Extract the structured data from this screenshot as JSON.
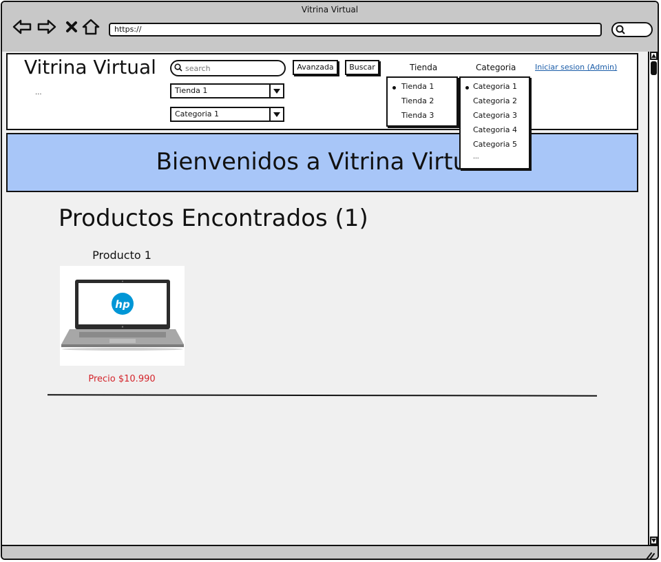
{
  "window": {
    "title": "Vitrina Virtual"
  },
  "browser": {
    "url": "https://",
    "back_icon": "back-arrow-icon",
    "forward_icon": "forward-arrow-icon",
    "stop_icon": "close-icon",
    "home_icon": "home-icon",
    "search_icon": "search-icon"
  },
  "header": {
    "site_title": "Vitrina Virtual",
    "subtitle": "...",
    "search_placeholder": "search",
    "store_select_value": "Tienda 1",
    "category_select_value": "Categoria 1",
    "advanced_button": "Avanzada",
    "search_button": "Buscar",
    "store_menu_label": "Tienda",
    "category_menu_label": "Categoria",
    "login_link": "Iniciar sesion (Admin)"
  },
  "store_dropdown": {
    "items": [
      "Tienda 1",
      "Tienda 2",
      "Tienda 3"
    ],
    "selected": "Tienda 1"
  },
  "category_dropdown": {
    "items": [
      "Categoria 1",
      "Categoria 2",
      "Categoria 3",
      "Categoria 4",
      "Categoria 5",
      "..."
    ],
    "selected": "Categoria 1"
  },
  "banner": {
    "text": "Bienvenidos a Vitrina Virtual"
  },
  "results": {
    "title": "Productos Encontrados (1)",
    "products": [
      {
        "name": "Producto 1",
        "price": "Precio $10.990",
        "image_logo": "hp"
      }
    ]
  },
  "colors": {
    "banner": "#a8c6f8",
    "price": "#d4242b",
    "link": "#1a5ca8",
    "chrome": "#c8c8c8",
    "hp_blue": "#0096d6"
  }
}
